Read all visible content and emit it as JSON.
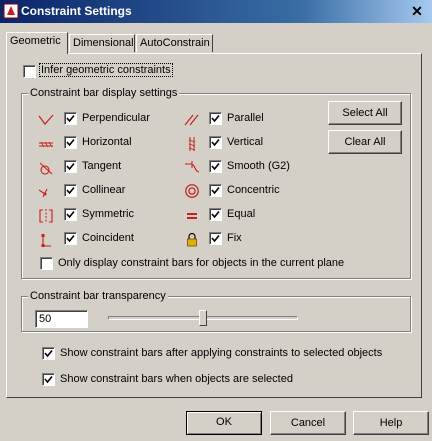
{
  "window": {
    "title": "Constraint Settings",
    "close_glyph": "✕"
  },
  "tabs": [
    {
      "label": "Geometric",
      "active": true
    },
    {
      "label": "Dimensional",
      "active": false
    },
    {
      "label": "AutoConstrain",
      "active": false
    }
  ],
  "infer": {
    "label": "Infer geometric constraints",
    "checked": false
  },
  "constraint_bar_group": {
    "title": "Constraint bar display settings",
    "left_items": [
      {
        "label": "Perpendicular",
        "icon": "perpendicular-icon",
        "checked": true
      },
      {
        "label": "Horizontal",
        "icon": "horizontal-icon",
        "checked": true
      },
      {
        "label": "Tangent",
        "icon": "tangent-icon",
        "checked": true
      },
      {
        "label": "Collinear",
        "icon": "collinear-icon",
        "checked": true
      },
      {
        "label": "Symmetric",
        "icon": "symmetric-icon",
        "checked": true
      },
      {
        "label": "Coincident",
        "icon": "coincident-icon",
        "checked": true
      }
    ],
    "right_items": [
      {
        "label": "Parallel",
        "icon": "parallel-icon",
        "checked": true
      },
      {
        "label": "Vertical",
        "icon": "vertical-icon",
        "checked": true
      },
      {
        "label": "Smooth (G2)",
        "icon": "smooth-icon",
        "checked": true
      },
      {
        "label": "Concentric",
        "icon": "concentric-icon",
        "checked": true
      },
      {
        "label": "Equal",
        "icon": "equal-icon",
        "checked": true
      },
      {
        "label": "Fix",
        "icon": "lock-icon",
        "checked": true
      }
    ],
    "select_all_label": "Select All",
    "clear_all_label": "Clear All",
    "current_plane": {
      "label": "Only display constraint bars for objects in the current plane",
      "checked": false
    }
  },
  "transparency_group": {
    "title": "Constraint bar transparency",
    "value": "50",
    "slider_fraction": 0.5
  },
  "options": [
    {
      "label": "Show constraint bars after applying constraints to selected objects",
      "checked": true
    },
    {
      "label": "Show constraint bars when objects are selected",
      "checked": true
    }
  ],
  "footer": {
    "ok_label": "OK",
    "cancel_label": "Cancel",
    "help_label": "Help"
  },
  "colors": {
    "icon_red": "#c81e1e",
    "title_blue": "#0a246a"
  }
}
